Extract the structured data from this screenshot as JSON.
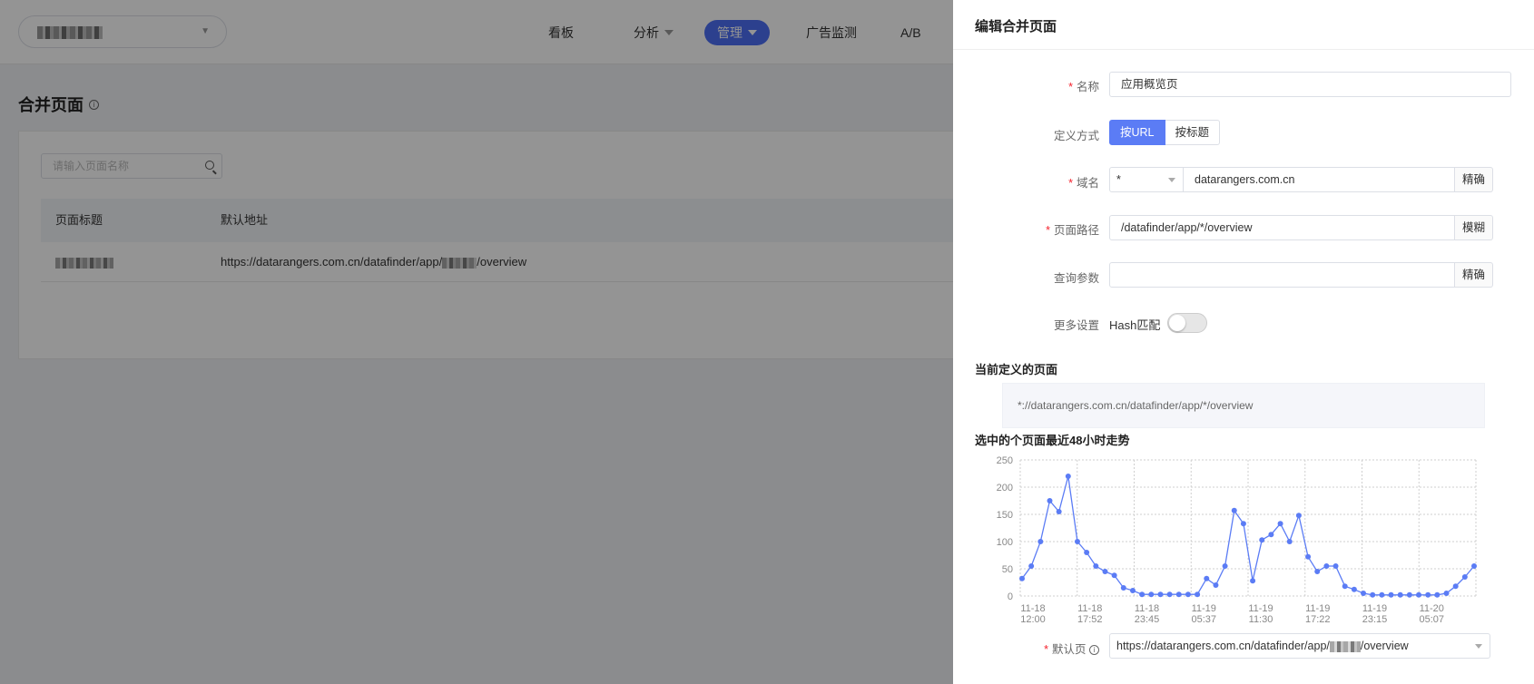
{
  "header": {
    "nav": [
      {
        "label": "看板",
        "has_caret": false,
        "active": false
      },
      {
        "label": "分析",
        "has_caret": true,
        "active": false
      },
      {
        "label": "管理",
        "has_caret": true,
        "active": true
      },
      {
        "label": "广告监测",
        "has_caret": false,
        "active": false
      },
      {
        "label": "A/B",
        "has_caret": false,
        "active": false
      }
    ]
  },
  "page": {
    "title": "合并页面",
    "search_placeholder": "请输入页面名称",
    "table": {
      "columns": [
        "页面标题",
        "默认地址"
      ],
      "row_url_prefix": "https://datarangers.com.cn/datafinder/app/",
      "row_url_suffix": "/overview"
    }
  },
  "drawer": {
    "title": "编辑合并页面",
    "name_label": "名称",
    "name_value": "应用概览页",
    "define_label": "定义方式",
    "define_options": [
      "按URL",
      "按标题"
    ],
    "domain_label": "域名",
    "domain_protocol": "*",
    "domain_value": "datarangers.com.cn",
    "domain_match": "精确",
    "path_label": "页面路径",
    "path_value": "/datafinder/app/*/overview",
    "path_match": "模糊",
    "query_label": "查询参数",
    "query_value": "",
    "query_match": "精确",
    "more_label": "更多设置",
    "hash_label": "Hash匹配",
    "hash_enabled": false,
    "current_title": "当前定义的页面",
    "current_value": "*://datarangers.com.cn/datafinder/app/*/overview",
    "trend_title": "选中的个页面最近48小时走势",
    "default_label": "默认页",
    "default_url_prefix": "https://datarangers.com.cn/datafinder/app/",
    "default_url_suffix": "/overview"
  },
  "colors": {
    "accent": "#4c6ef5",
    "line": "#5b7cf5",
    "required": "#f5222d"
  },
  "chart_data": {
    "type": "line",
    "title": "选中的个页面最近48小时走势",
    "ylim": [
      0,
      250
    ],
    "yticks": [
      0,
      50,
      100,
      150,
      200,
      250
    ],
    "xtick_labels": [
      [
        "11-18",
        "12:00"
      ],
      [
        "11-18",
        "17:52"
      ],
      [
        "11-18",
        "23:45"
      ],
      [
        "11-19",
        "05:37"
      ],
      [
        "11-19",
        "11:30"
      ],
      [
        "11-19",
        "17:22"
      ],
      [
        "11-19",
        "23:15"
      ],
      [
        "11-20",
        "05:07"
      ]
    ],
    "values": [
      32,
      55,
      100,
      175,
      155,
      220,
      100,
      80,
      55,
      45,
      38,
      15,
      10,
      3,
      3,
      3,
      3,
      3,
      3,
      3,
      32,
      20,
      55,
      157,
      133,
      28,
      103,
      113,
      133,
      100,
      148,
      72,
      45,
      55,
      55,
      18,
      12,
      5,
      2,
      2,
      2,
      2,
      2,
      2,
      2,
      2,
      5,
      18,
      35,
      55
    ],
    "grid": true,
    "legend": "none"
  }
}
